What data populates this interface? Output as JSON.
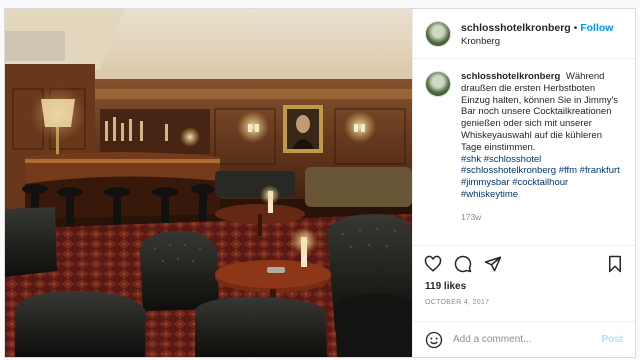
{
  "post": {
    "username": "schlosshotelkronberg",
    "separator": "•",
    "follow_label": "Follow",
    "location": "Kronberg",
    "caption": {
      "username": "schlosshotelkronberg",
      "text": "Während draußen die ersten Herbstboten Einzug halten, können Sie in Jimmy's Bar noch unsere Cocktailkreationen genießen oder sich mit unserer Whiskeyauswahl auf die kühleren Tage einstimmen.",
      "hashtags": [
        "#shk",
        "#schlosshotel",
        "#schlosshotelkronberg",
        "#ffm",
        "#frankfurt",
        "#jimmysbar",
        "#cocktailhour",
        "#whiskeytime"
      ],
      "age": "173w"
    },
    "actions": {
      "like_icon": "heart-icon",
      "comment_icon": "comment-icon",
      "share_icon": "share-icon",
      "save_icon": "bookmark-icon"
    },
    "likes": "119 likes",
    "date": "OCTOBER 4, 2017",
    "comment_placeholder": "Add a comment...",
    "post_label": "Post",
    "image_alt": "Jimmy's Bar interior with wood paneling, bar counter and leather chesterfield armchairs"
  },
  "colors": {
    "accent": "#0095f6",
    "post_disabled": "#b2dffc",
    "hashtag": "#00376b"
  }
}
